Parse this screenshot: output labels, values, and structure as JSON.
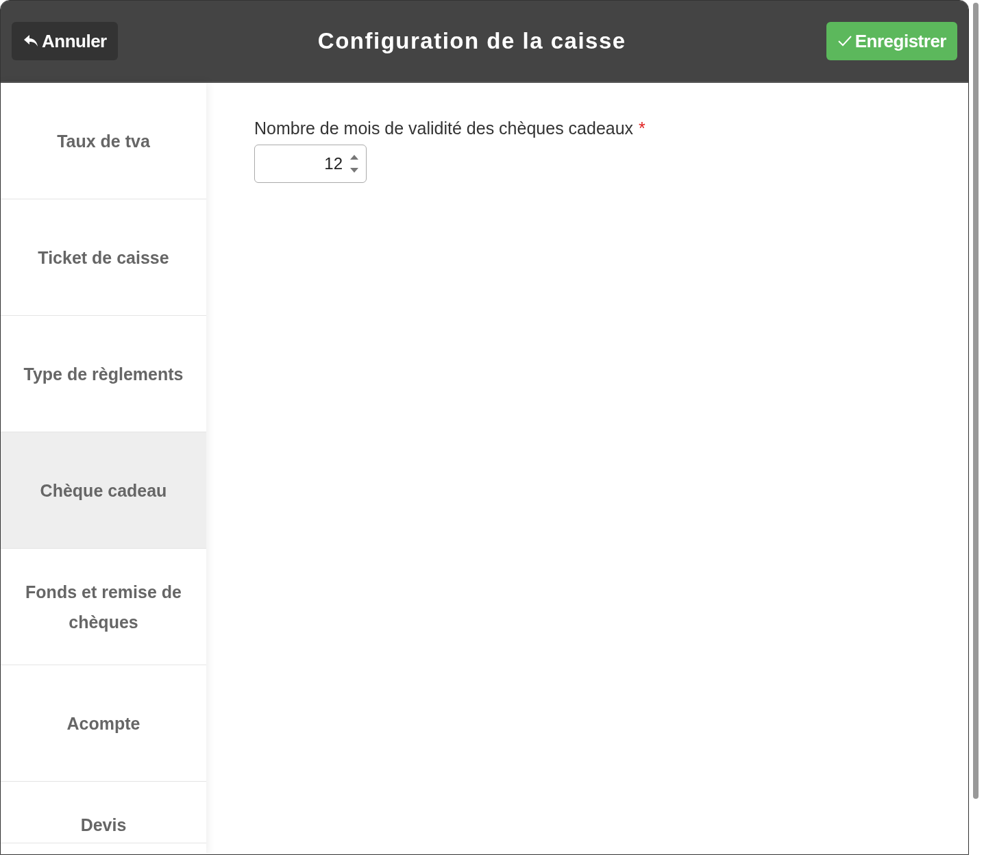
{
  "header": {
    "cancel_button": "Annuler",
    "title": "Configuration de la caisse",
    "save_button": "Enregistrer"
  },
  "sidebar": {
    "items": [
      {
        "label": "Taux de tva",
        "selected": false
      },
      {
        "label": "Ticket de caisse",
        "selected": false
      },
      {
        "label": "Type de règlements",
        "selected": false
      },
      {
        "label": "Chèque cadeau",
        "selected": true
      },
      {
        "label": "Fonds et remise de chèques",
        "selected": false
      },
      {
        "label": "Acompte",
        "selected": false
      },
      {
        "label": "Devis",
        "selected": false
      }
    ]
  },
  "form": {
    "fields": [
      {
        "label": "Nombre de mois de validité des chèques cadeaux",
        "required_mark": "*",
        "value": "12"
      }
    ]
  }
}
